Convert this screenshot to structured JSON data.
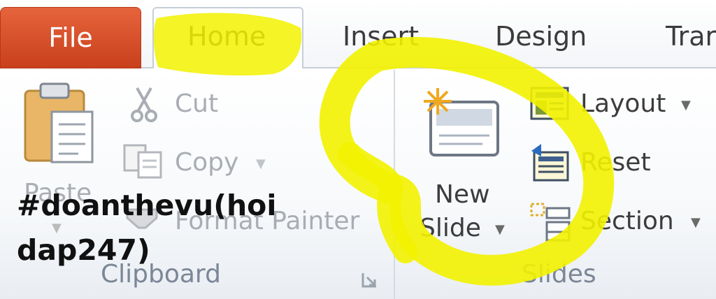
{
  "tabs": {
    "file": "File",
    "home": "Home",
    "insert": "Insert",
    "design": "Design",
    "transitions": "Trar"
  },
  "clipboard": {
    "paste": "Paste",
    "cut": "Cut",
    "copy": "Copy",
    "format_painter": "Format Painter",
    "group_label": "Clipboard"
  },
  "slides": {
    "new_slide_line1": "New",
    "new_slide_line2": "Slide",
    "layout": "Layout",
    "reset": "Reset",
    "section": "Section",
    "group_label": "Slides"
  },
  "overlay": {
    "line1": "#doanthevu(hoi",
    "line2": "dap247)"
  },
  "colors": {
    "file_tab": "#d24a24",
    "highlight": "#f2f200"
  },
  "icons": [
    "paste-icon",
    "cut-icon",
    "copy-icon",
    "format-painter-icon",
    "new-slide-icon",
    "layout-icon",
    "reset-icon",
    "section-icon",
    "dialog-launcher-icon"
  ]
}
